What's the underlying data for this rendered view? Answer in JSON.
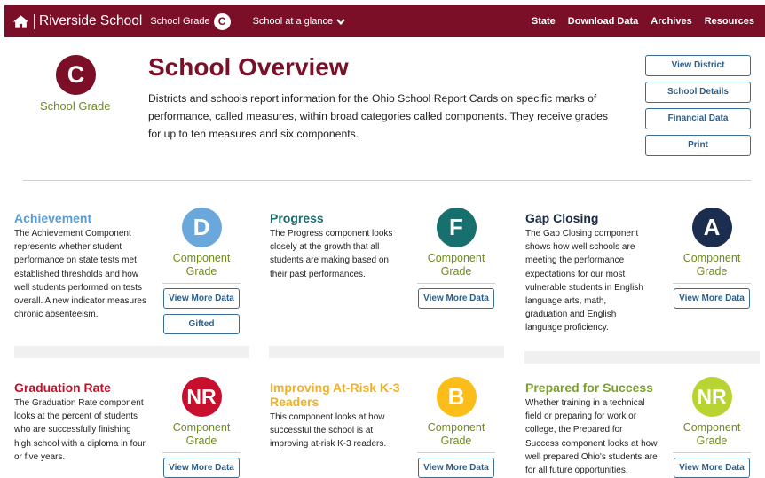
{
  "nav": {
    "school_name": "Riverside School",
    "grade_label": "School Grade",
    "grade": "C",
    "glance_label": "School at a glance",
    "links": [
      "State",
      "Download Data",
      "Archives",
      "Resources"
    ]
  },
  "header": {
    "grade": "C",
    "grade_label": "School Grade",
    "title": "School Overview",
    "intro": "Districts and schools report information for the Ohio School Report Cards on specific marks of performance, called measures, within broad categories called components. They receive grades for up to ten measures and six components.",
    "buttons": [
      "View District",
      "School Details",
      "Financial Data",
      "Print"
    ]
  },
  "colors": {
    "brand": "#7a0f27",
    "grade_label": "#6f8a1e",
    "button_text": "#2b5f8a"
  },
  "components": [
    {
      "title": "Achievement",
      "title_color": "#5b9bd5",
      "description": "The Achievement Component represents whether student performance on state tests met established thresholds and how well students performed on tests overall. A new indicator measures chronic absenteeism.",
      "grade": "D",
      "grade_color": "#6aa8dc",
      "grade_label": "Component Grade",
      "buttons": [
        "View More Data",
        "Gifted"
      ]
    },
    {
      "title": "Progress",
      "title_color": "#1c6b6b",
      "description": "The Progress component looks closely at the growth that all students are making based on their past performances.",
      "grade": "F",
      "grade_color": "#17706e",
      "grade_label": "Component Grade",
      "buttons": [
        "View More Data"
      ]
    },
    {
      "title": "Gap Closing",
      "title_color": "#1b2a45",
      "description": "The Gap Closing component shows how well schools are meeting the performance expectations for our most vulnerable students in English language arts, math, graduation and English language proficiency.",
      "grade": "A",
      "grade_color": "#1b2e4f",
      "grade_label": "Component Grade",
      "buttons": [
        "View More Data"
      ]
    },
    {
      "title": "Graduation Rate",
      "title_color": "#c0112b",
      "description": "The Graduation Rate component looks at the percent of students who are successfully finishing high school with a diploma in four or five years.",
      "grade": "NR",
      "grade_color": "#c8102e",
      "grade_label": "Component Grade",
      "buttons": [
        "View More Data"
      ]
    },
    {
      "title": "Improving At-Risk K-3 Readers",
      "title_color": "#f2b01e",
      "description": "This component looks at how successful the school is at improving at-risk K-3 readers.",
      "grade": "B",
      "grade_color": "#fbbd1a",
      "grade_label": "Component Grade",
      "buttons": [
        "View More Data"
      ]
    },
    {
      "title": "Prepared for Success",
      "title_color": "#7ca12a",
      "description": "Whether training in a technical field or preparing for work or college, the Prepared for Success component looks at how well prepared Ohio's students are for all future opportunities.",
      "grade": "NR",
      "grade_color": "#b7d433",
      "grade_label": "Component Grade",
      "buttons": [
        "View More Data"
      ]
    }
  ]
}
